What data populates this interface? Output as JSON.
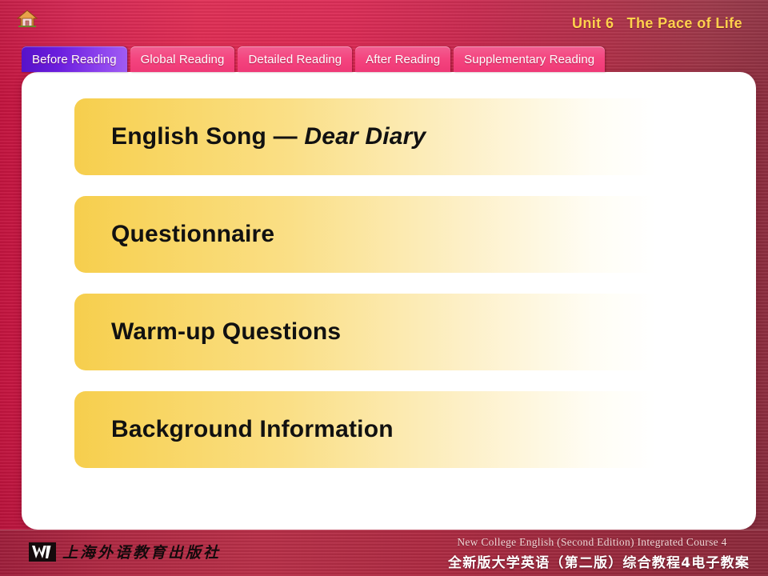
{
  "header": {
    "home_icon": "home-icon",
    "unit_title": "Unit 6   The Pace of Life"
  },
  "tabs": [
    {
      "label": "Before Reading",
      "active": true
    },
    {
      "label": "Global Reading",
      "active": false
    },
    {
      "label": "Detailed Reading",
      "active": false
    },
    {
      "label": "After Reading",
      "active": false
    },
    {
      "label": "Supplementary Reading",
      "active": false
    }
  ],
  "menu": {
    "items": [
      {
        "text_plain": "English Song — ",
        "text_italic": "Dear Diary",
        "full": "English Song — Dear Diary"
      },
      {
        "text_plain": "Questionnaire",
        "text_italic": "",
        "full": "Questionnaire"
      },
      {
        "text_plain": "Warm-up Questions",
        "text_italic": "",
        "full": "Warm-up Questions"
      },
      {
        "text_plain": "Background Information",
        "text_italic": "",
        "full": "Background Information"
      }
    ]
  },
  "footer": {
    "publisher_logo": "w-logo",
    "publisher_name_cn": "上海外语教育出版社",
    "course_title_en": "New College English (Second Edition) Integrated Course 4",
    "course_title_cn": "全新版大学英语（第二版）综合教程4电子教案"
  },
  "colors": {
    "background_crimson": "#d8234a",
    "background_maroon": "#9b3143",
    "tab_inactive": "#f4457f",
    "tab_active": "#6b1ede",
    "unit_title_gold": "#ffd24d",
    "menu_gold": "#f6ce4d",
    "panel_white": "#ffffff",
    "footer_red": "#b22a44"
  }
}
